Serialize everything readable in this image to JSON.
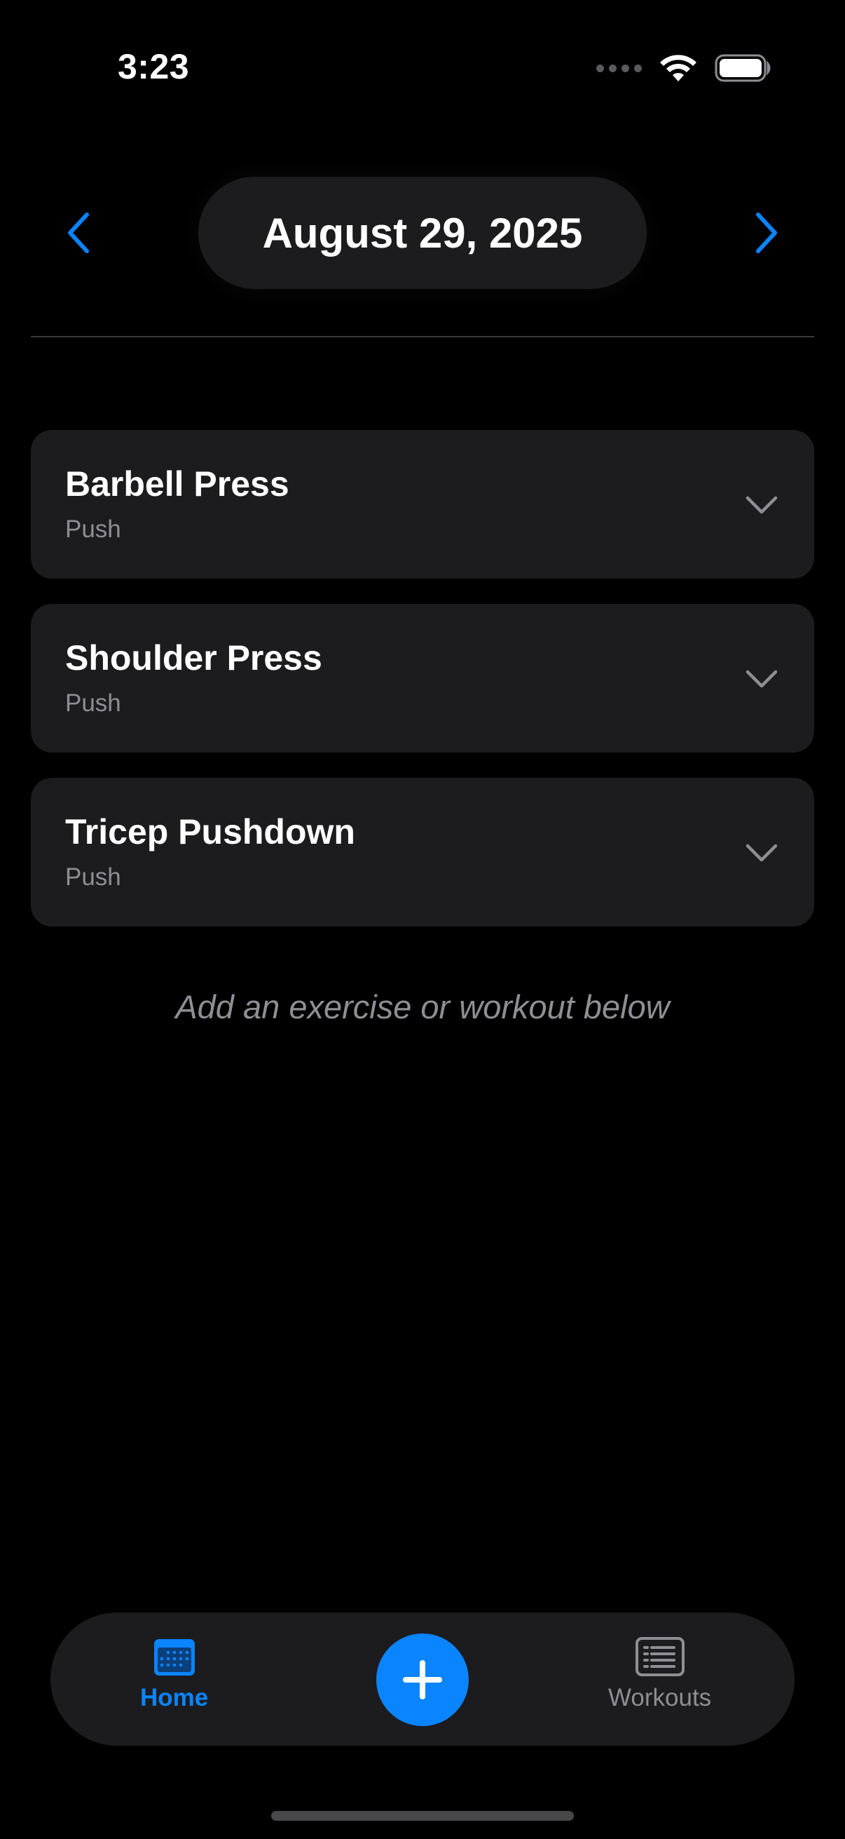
{
  "status_bar": {
    "time": "3:23"
  },
  "header": {
    "date": "August 29, 2025"
  },
  "exercises": [
    {
      "name": "Barbell Press",
      "category": "Push"
    },
    {
      "name": "Shoulder Press",
      "category": "Push"
    },
    {
      "name": "Tricep Pushdown",
      "category": "Push"
    }
  ],
  "hint": "Add an exercise or workout below",
  "tabbar": {
    "home_label": "Home",
    "workouts_label": "Workouts"
  },
  "colors": {
    "accent": "#0a84ff",
    "card": "#1c1c1e",
    "secondary_text": "#8e8e93",
    "background": "#000000"
  },
  "icons": {
    "prev": "chevron-left-icon",
    "next": "chevron-right-icon",
    "expand": "chevron-down-icon",
    "home": "calendar-icon",
    "add": "plus-icon",
    "workouts": "list-icon"
  }
}
